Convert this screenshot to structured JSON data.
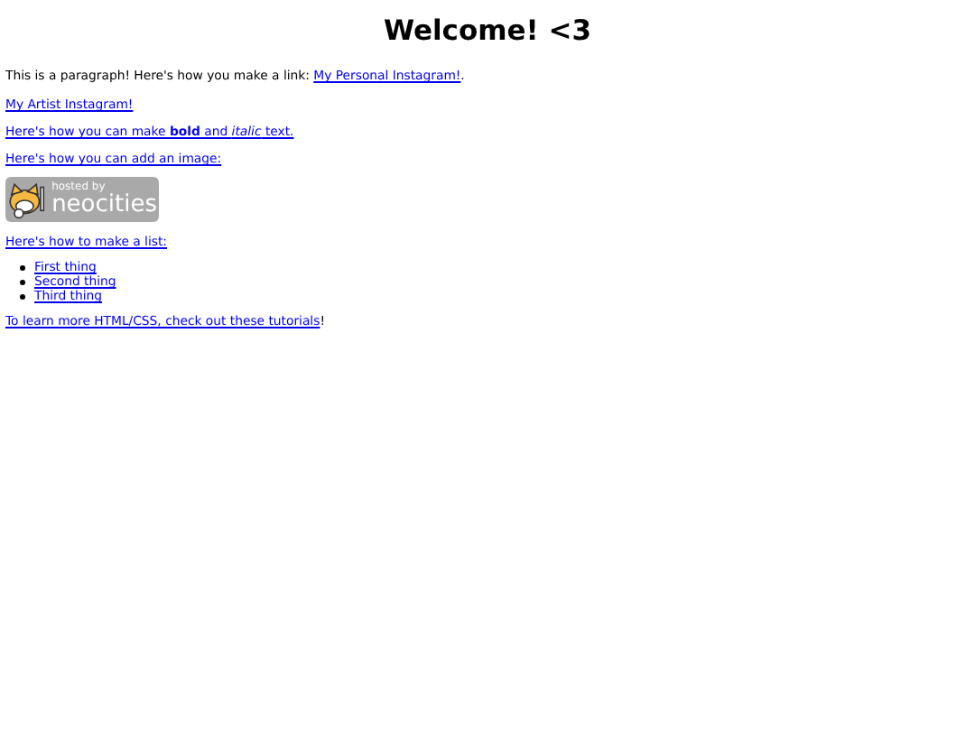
{
  "title": "Welcome! <3",
  "intro": {
    "text": "This is a paragraph! Here's how you make a link: ",
    "link": "My Personal Instagram!",
    "after": "."
  },
  "links": [
    "My Artist Instagram!",
    "Here's how you can make **bold** and *italic* text.",
    "Here's how you can add an image:"
  ],
  "badge": {
    "caption": "hosted by",
    "name": "neocities"
  },
  "list_heading": "Here's how to make a list:",
  "list_items": [
    "First thing",
    "Second thing",
    "Third thing"
  ],
  "footer": {
    "link": "To learn more HTML/CSS, check out these tutorials",
    "after": "!"
  }
}
